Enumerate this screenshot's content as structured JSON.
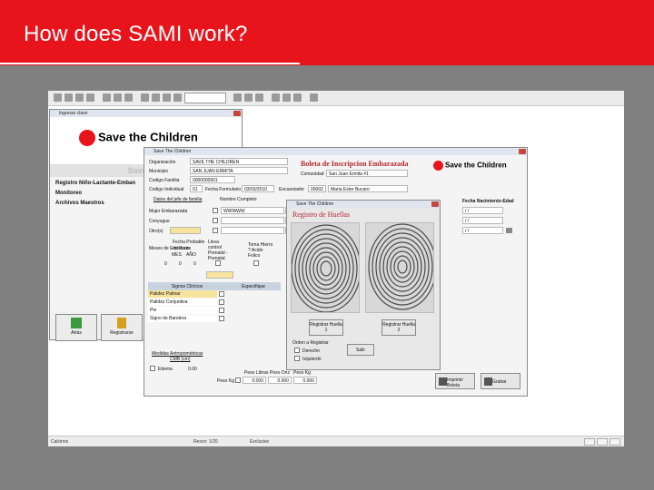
{
  "slide": {
    "title": "How does SAMI work?"
  },
  "colors": {
    "banner": "#e8141c",
    "slide_bg": "#808080"
  },
  "statusbar": {
    "left": "Calcinos",
    "middle": "Rexcn: 1/20",
    "right": "Exclusive"
  },
  "login_window": {
    "title": "Ingresar clave",
    "logo_text": "Save the Children",
    "subtitle": "Save The",
    "menu": [
      "Registro Niño-Lactante-Emban",
      "Monitoreo",
      "Archivos Maestros"
    ],
    "buttons": {
      "back": "Atrás",
      "register": "Registrarse"
    }
  },
  "form_window": {
    "title": "Save The Children",
    "header_title": "Boleta de Inscripcion Embarazada",
    "logo_text": "Save the Children",
    "fields": {
      "org_label": "Organización",
      "org_value": "SAVE THE CHILDREN",
      "municipio_label": "Municipio",
      "municipio_value": "SAN JUAN ERMITA",
      "familia_label": "Codigo Familia",
      "familia_value": "0000000001",
      "individual_label": "Codigo Individual",
      "individual_value": "01",
      "fecha_label": "Fecha Formulario",
      "fecha_value": "03/03/2010",
      "encuestador_label": "Encuestador",
      "encuestador_code": "00002",
      "encuestador_name": "Maria Ester Bucaro",
      "comunidad_label": "Comunidad",
      "comunidad_value": "San Juan Ermita #1"
    },
    "names": {
      "section_label": "Datos del jefe de familia",
      "nombre_label": "Nombre Completo",
      "fecha_nac_label": "Fecha Nacimiento-Edad",
      "row_labels": [
        "Mujer Embarazada",
        "Conyugue",
        "Otro(s)"
      ],
      "embarazada_value": "WWWWW",
      "date_placeholder": "/ /"
    },
    "parto": {
      "fecha_label": "Fecha Probable",
      "meses_label": "Meses de Embarazo",
      "parto_label": "de Parto",
      "mes_label": "MES",
      "ano_label": "AÑO",
      "values": [
        "0",
        "0",
        "0"
      ],
      "control_label": "Lleva control Prenatal - Prenatal",
      "hierro_label": "Toma Hierro ? Acido Folico"
    },
    "signos": {
      "col1": "Signos Clínicos",
      "col2": "Especifique",
      "items": [
        "Palidez Palmar",
        "Palidez Conjuntiva",
        "Pie",
        "Signo de Bandera"
      ]
    },
    "antropometria": {
      "label": "Medidas Antropométricas",
      "cmb_label": "CMB (cm)",
      "edema_label": "Edema",
      "edema_value": "0.00",
      "peso_kg_label": "Peso Kg",
      "peso_libras_label": "Peso Libras",
      "peso_onz_label": "Peso Onz",
      "peso_kg2_label": "Peso Kg",
      "peso_values": [
        "0.000",
        "0.000",
        "0.000"
      ]
    },
    "buttons": {
      "print": "Imprimir Boleta",
      "save": "Grabar"
    }
  },
  "fingerprint_window": {
    "title": "Save The Children",
    "header": "Registro de Huellas",
    "buttons": {
      "h1": "Registrar Huella 1",
      "h2": "Registrar Huella 2",
      "exit": "Salir"
    },
    "order_label": "Orden a Registrar",
    "options": [
      "Derecho",
      "Izquierdo"
    ]
  }
}
